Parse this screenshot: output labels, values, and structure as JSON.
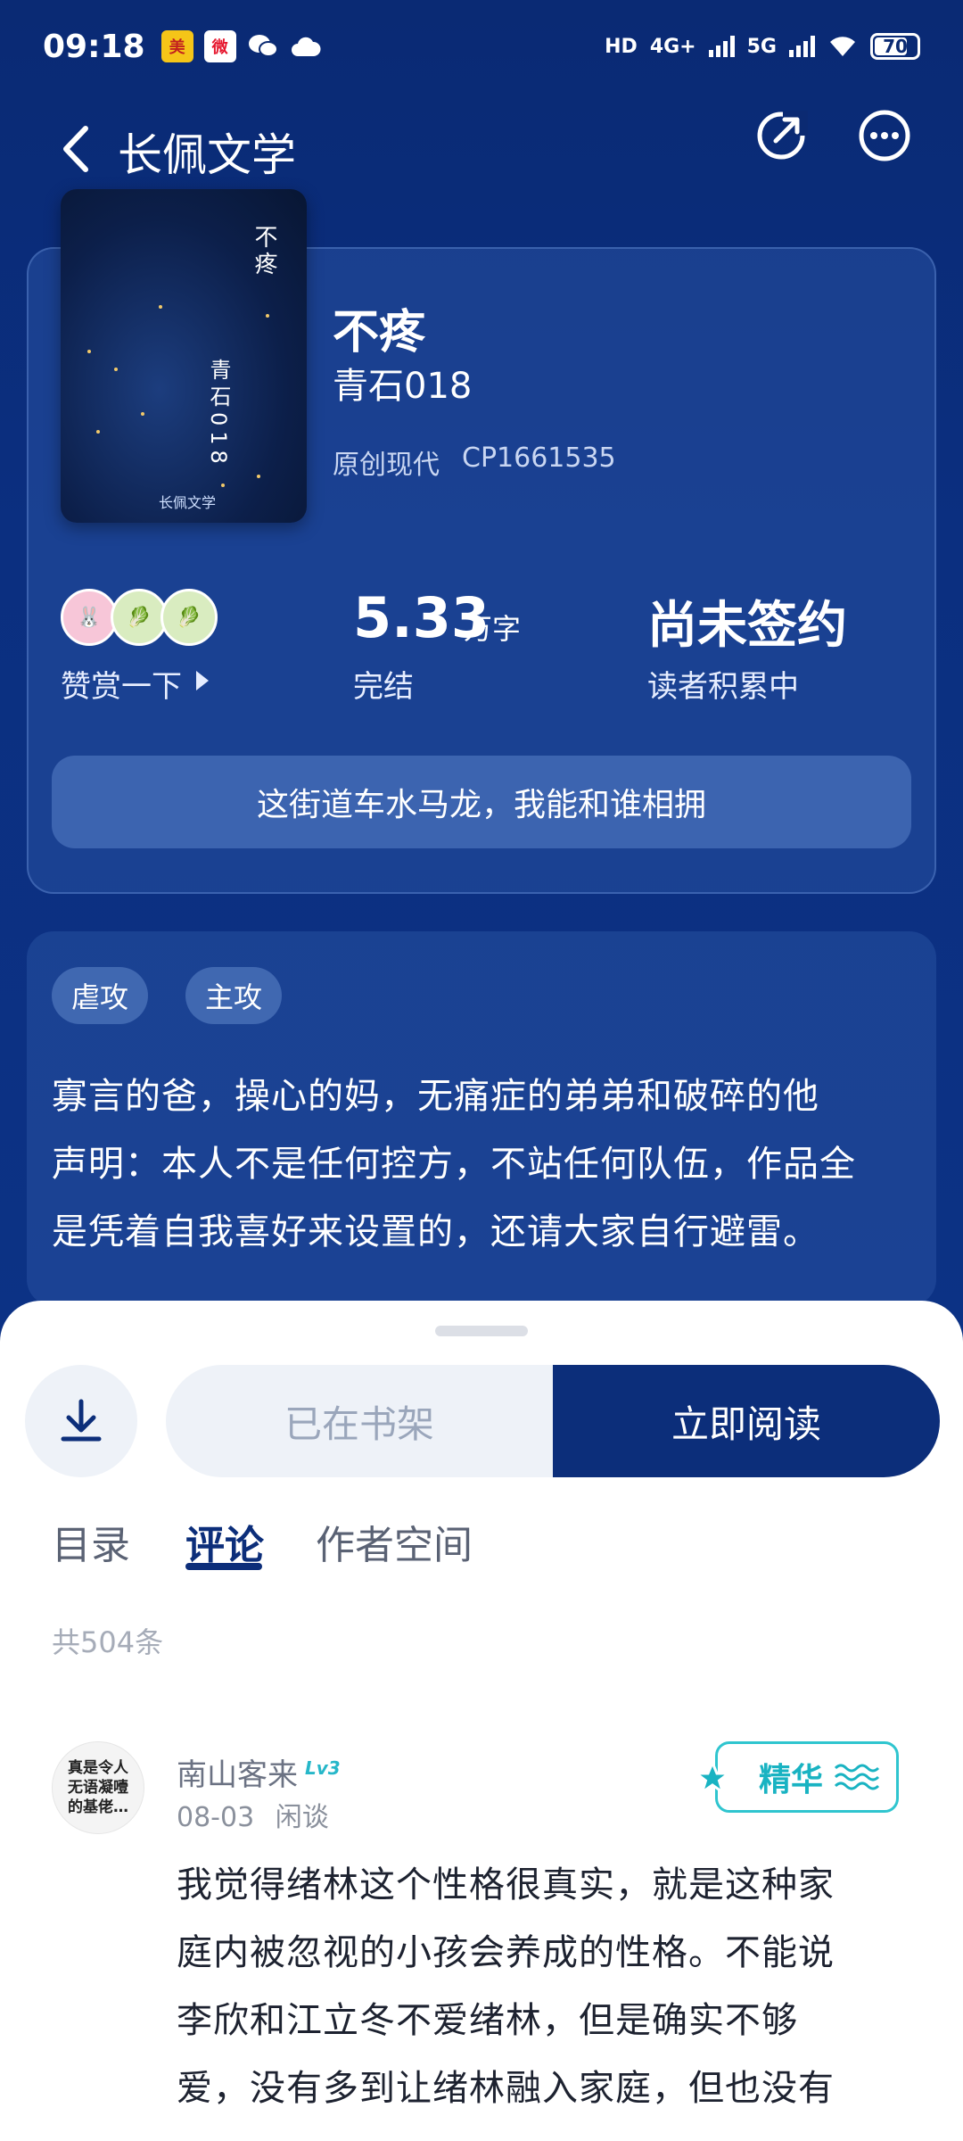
{
  "status_bar": {
    "time": "09:18",
    "battery": "70",
    "network_1": "HD",
    "network_2": "4G+",
    "network_3": "5G"
  },
  "header": {
    "title": "长佩文学"
  },
  "book": {
    "title": "不疼",
    "author": "青石018",
    "category": "原创现代",
    "cp_id": "CP1661535",
    "cover_title": "不疼",
    "cover_author": "青石018",
    "cover_logo": "长佩文学",
    "praise_label": "赞赏一下",
    "word_count": "5.33",
    "word_unit": "万字",
    "status": "完结",
    "sign_status": "尚未签约",
    "sign_sub": "读者积累中",
    "tagline": "这街道车水马龙，我能和谁相拥"
  },
  "intro": {
    "tags": [
      "虐攻",
      "主攻"
    ],
    "lines": [
      "寡言的爸，操心的妈，无痛症的弟弟和破碎的他",
      "声明：本人不是任何控方，不站任何队伍，作品全",
      "是凭着自我喜好来设置的，还请大家自行避雷。"
    ]
  },
  "actions": {
    "shelf_label": "已在书架",
    "read_label": "立即阅读"
  },
  "tabs": [
    {
      "label": "目录"
    },
    {
      "label": "评论"
    },
    {
      "label": "作者空间"
    }
  ],
  "comments": {
    "count_label": "共504条",
    "items": [
      {
        "avatar_text": [
          "真是令人",
          "无语凝噎",
          "的基佬…"
        ],
        "name": "南山客来",
        "level": "Lv3",
        "date": "08-03",
        "category": "闲谈",
        "badge": "精华",
        "lines": [
          "我觉得绪林这个性格很真实，就是这种家",
          "庭内被忽视的小孩会养成的性格。不能说",
          "李欣和江立冬不爱绪林，但是确实不够",
          "爱，没有多到让绪林融入家庭，但也没有"
        ]
      }
    ]
  },
  "colors": {
    "background": "#0b2a72",
    "accent": "#0c2e7a",
    "badge": "#19b3c2"
  }
}
